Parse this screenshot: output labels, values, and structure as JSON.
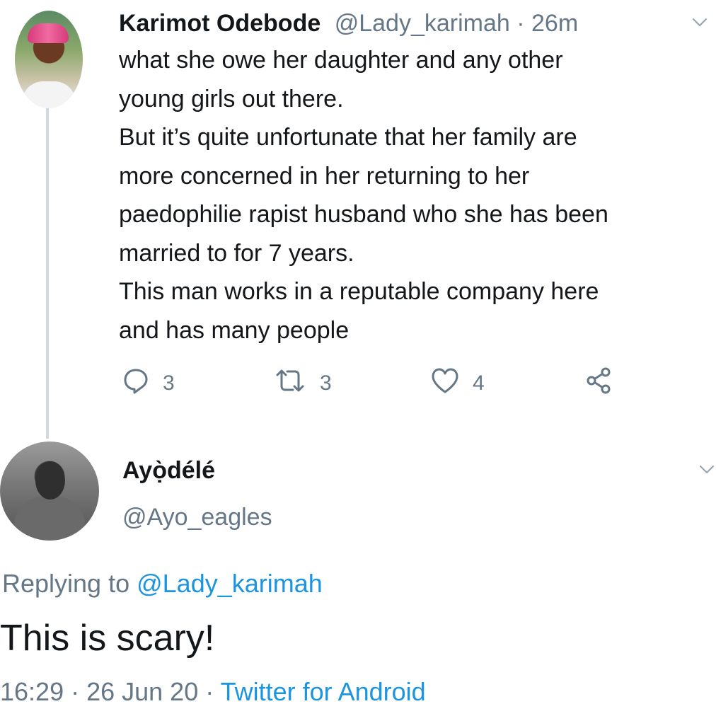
{
  "tweet1": {
    "author_name": "Karimot Odebode",
    "handle": "@Lady_karimah",
    "separator": " · ",
    "time": "26m",
    "body_lines": [
      "what she owe her daughter and any other",
      "young girls out there.",
      "But it’s quite unfortunate that her family are",
      "more concerned in her returning to her",
      "paedophilie rapist husband who she has been",
      "married to for 7 years.",
      "This man works in a reputable company here",
      "and has many people"
    ],
    "actions": {
      "reply_count": "3",
      "retweet_count": "3",
      "like_count": "4"
    },
    "icons": {
      "reply": "reply-icon",
      "retweet": "retweet-icon",
      "like": "heart-icon",
      "share": "share-icon",
      "menu": "chevron-down-icon"
    }
  },
  "tweet2": {
    "author_name": "Ayọ̀délé",
    "handle": "@Ayo_eagles",
    "replying_prefix": "Replying to ",
    "replying_to": "@Lady_karimah",
    "text": "This is scary!",
    "timestamp": "16:29 · 26 Jun 20 · ",
    "source": "Twitter for Android"
  },
  "colors": {
    "text": "#14171a",
    "muted": "#657786",
    "link": "#1b95e0",
    "thread_line": "#cfd9de"
  }
}
